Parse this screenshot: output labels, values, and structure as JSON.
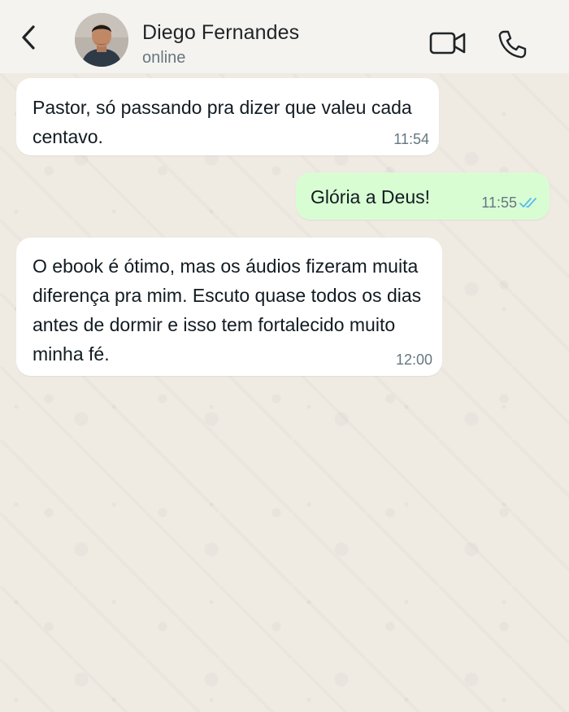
{
  "header": {
    "back_icon": "chevron-left-icon",
    "contact_name": "Diego Fernandes",
    "contact_status": "online",
    "video_icon": "video-camera-icon",
    "call_icon": "phone-icon"
  },
  "messages": [
    {
      "direction": "incoming",
      "text": "Pastor, só passando pra dizer que valeu cada centavo.",
      "time": "11:54"
    },
    {
      "direction": "outgoing",
      "text": "Glória a Deus!",
      "time": "11:55",
      "status_icon": "double-check-read-icon"
    },
    {
      "direction": "incoming",
      "text": "O ebook é ótimo, mas os áudios fizeram muita diferença pra mim. Escuto quase todos os dias antes de dormir e isso tem fortalecido muito minha fé.",
      "time": "12:00"
    }
  ],
  "colors": {
    "chat_background": "#efeae2",
    "incoming_bubble": "#ffffff",
    "outgoing_bubble": "#d9fdd3",
    "read_ticks": "#53bdeb"
  }
}
